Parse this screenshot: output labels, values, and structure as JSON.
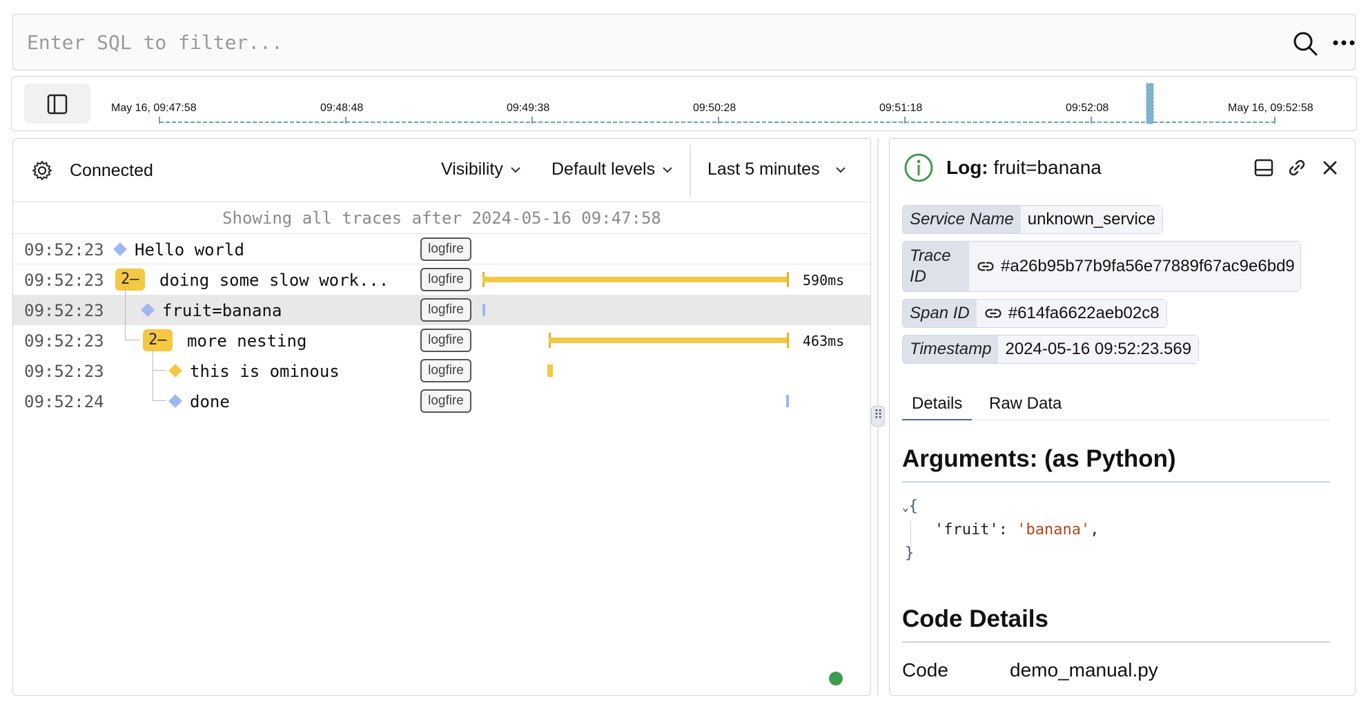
{
  "search": {
    "placeholder": "Enter SQL to filter..."
  },
  "timeline": {
    "ticks": [
      "May 16, 09:47:58",
      "09:48:48",
      "09:49:38",
      "09:50:28",
      "09:51:18",
      "09:52:08",
      "May 16, 09:52:58"
    ]
  },
  "left_panel": {
    "status": "Connected",
    "visibility_label": "Visibility",
    "levels_label": "Default levels",
    "range_label": "Last 5 minutes",
    "info": "Showing all traces after 2024-05-16 09:47:58",
    "rows": [
      {
        "time": "09:52:23",
        "message": "Hello world",
        "tag": "logfire",
        "badge": "",
        "duration": ""
      },
      {
        "time": "09:52:23",
        "message": "doing some slow work...",
        "tag": "logfire",
        "badge": "2–",
        "duration": "590ms"
      },
      {
        "time": "09:52:23",
        "message": "fruit=banana",
        "tag": "logfire",
        "badge": "",
        "duration": ""
      },
      {
        "time": "09:52:23",
        "message": "more nesting",
        "tag": "logfire",
        "badge": "2–",
        "duration": "463ms"
      },
      {
        "time": "09:52:23",
        "message": "this is ominous",
        "tag": "logfire",
        "badge": "",
        "duration": ""
      },
      {
        "time": "09:52:24",
        "message": "done",
        "tag": "logfire",
        "badge": "",
        "duration": ""
      }
    ]
  },
  "detail": {
    "title_prefix": "Log:",
    "title": "fruit=banana",
    "attributes": {
      "service_name_key": "Service Name",
      "service_name_val": "unknown_service",
      "trace_id_key_1": "Trace",
      "trace_id_key_2": "ID",
      "trace_id_val": "#a26b95b77b9fa56e77889f67ac9e6bd9",
      "span_id_key": "Span ID",
      "span_id_val": "#614fa6622aeb02c8",
      "timestamp_key": "Timestamp",
      "timestamp_val": "2024-05-16 09:52:23.569"
    },
    "tabs": [
      "Details",
      "Raw Data"
    ],
    "arguments_title": "Arguments: (as Python)",
    "args_open": "{",
    "args_key": "'fruit'",
    "args_colon": ":",
    "args_value": "'banana'",
    "args_comma": ",",
    "args_close": "}",
    "code_title": "Code Details",
    "code_label": "Code",
    "code_value": "demo_manual.py"
  },
  "colors": {
    "span_bar": "#f2c940",
    "log_marker": "#9fb6f0",
    "live": "#3f9b4f"
  }
}
